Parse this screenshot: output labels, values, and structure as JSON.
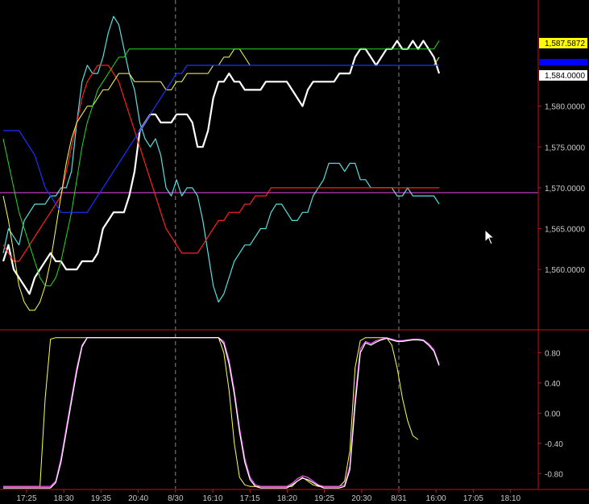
{
  "chart_data": [
    {
      "type": "line",
      "panel": "price",
      "ylim": [
        1553,
        1593
      ],
      "y_ticks": [
        "1,560.0000",
        "1,565.0000",
        "1,570.0000",
        "1,575.0000",
        "1,580.0000"
      ],
      "price_tags": [
        {
          "label": "1,587.5872",
          "bg": "#ffff00",
          "fg": "#000000",
          "value": 1587.5872
        },
        {
          "label": "",
          "bg": "#0000ff",
          "fg": "#ffffff",
          "value": 1585.4
        },
        {
          "label": "1,584.0000",
          "bg": "#ffffff",
          "fg": "#000000",
          "value": 1584.0
        }
      ],
      "hline": {
        "value": 1569.4,
        "color": "#cc44cc"
      },
      "series": [
        {
          "color": "#ffffff",
          "width": 2.2,
          "values": [
            1561,
            1563,
            1560,
            1559,
            1558,
            1557,
            1559,
            1560,
            1561,
            1562,
            1561,
            1561,
            1560,
            1560,
            1560,
            1561,
            1561,
            1561,
            1562,
            1565,
            1566,
            1567,
            1567,
            1567,
            1569,
            1572,
            1577,
            1578,
            1579,
            1579,
            1578,
            1578,
            1578,
            1579,
            1579,
            1579,
            1578,
            1575,
            1575,
            1577,
            1581,
            1583,
            1583,
            1584,
            1583,
            1583,
            1582,
            1582,
            1582,
            1582,
            1583,
            1583,
            1583,
            1583,
            1583,
            1582,
            1581,
            1580,
            1582,
            1583,
            1583,
            1583,
            1583,
            1583,
            1584,
            1584,
            1584,
            1586,
            1587,
            1587,
            1586,
            1585,
            1586,
            1587,
            1587,
            1588,
            1587,
            1587,
            1588,
            1587,
            1588,
            1587,
            1586,
            1584
          ]
        },
        {
          "color": "#55e0e0",
          "width": 1.2,
          "values": [
            1562,
            1565,
            1564,
            1563,
            1566,
            1567,
            1568,
            1568,
            1568,
            1569,
            1569,
            1570,
            1570,
            1572,
            1578,
            1583,
            1585,
            1584,
            1584,
            1586,
            1589,
            1591,
            1590,
            1587,
            1584,
            1582,
            1578,
            1576,
            1575,
            1576,
            1574,
            1570,
            1569,
            1571,
            1569,
            1570,
            1570,
            1569,
            1566,
            1562,
            1558,
            1556,
            1557,
            1559,
            1561,
            1562,
            1563,
            1563,
            1564,
            1565,
            1565,
            1567,
            1568,
            1568,
            1567,
            1566,
            1566,
            1567,
            1567,
            1569,
            1570,
            1571,
            1573,
            1573,
            1573,
            1572,
            1573,
            1573,
            1571,
            1571,
            1570,
            1570,
            1570,
            1570,
            1570,
            1569,
            1569,
            1570,
            1569,
            1569,
            1569,
            1569,
            1569,
            1568
          ]
        },
        {
          "color": "#ff2020",
          "width": 1.2,
          "values": [
            1563,
            1562,
            1561,
            1561,
            1562,
            1563,
            1564,
            1565,
            1566,
            1567,
            1568,
            1569,
            1572,
            1575,
            1578,
            1581,
            1583,
            1584,
            1585,
            1585,
            1585,
            1584,
            1583,
            1581,
            1579,
            1577,
            1575,
            1573,
            1571,
            1569,
            1567,
            1565,
            1564,
            1563,
            1562,
            1562,
            1562,
            1562,
            1563,
            1564,
            1565,
            1566,
            1566,
            1567,
            1567,
            1567,
            1568,
            1568,
            1569,
            1569,
            1569,
            1570,
            1570,
            1570,
            1570,
            1570,
            1570,
            1570,
            1570,
            1570,
            1570,
            1570,
            1570,
            1570,
            1570,
            1570,
            1570,
            1570,
            1570,
            1570,
            1570,
            1570,
            1570,
            1570,
            1570,
            1570,
            1570,
            1570,
            1570,
            1570,
            1570,
            1570,
            1570,
            1570
          ]
        },
        {
          "color": "#ffff55",
          "width": 1.0,
          "values": [
            1569,
            1566,
            1562,
            1558,
            1556,
            1555,
            1555,
            1556,
            1558,
            1561,
            1565,
            1569,
            1573,
            1576,
            1578,
            1579,
            1580,
            1580,
            1581,
            1582,
            1582,
            1583,
            1584,
            1584,
            1584,
            1583,
            1583,
            1583,
            1583,
            1583,
            1583,
            1582,
            1582,
            1583,
            1583,
            1584,
            1584,
            1584,
            1584,
            1584,
            1585,
            1585,
            1586,
            1586,
            1587,
            1587,
            1586,
            1585,
            1585,
            1585,
            1585,
            1585,
            1585,
            1585,
            1585,
            1585,
            1585,
            1585,
            1585,
            1585,
            1585,
            1585,
            1585,
            1585,
            1585,
            1585,
            1585,
            1585,
            1585,
            1585,
            1585,
            1585,
            1585,
            1585,
            1585,
            1585,
            1585,
            1585,
            1585,
            1585,
            1585,
            1585,
            1585,
            1586
          ]
        },
        {
          "color": "#22dd22",
          "width": 1.0,
          "values": [
            1576,
            1573,
            1570,
            1567,
            1565,
            1563,
            1561,
            1559,
            1558,
            1558,
            1559,
            1561,
            1564,
            1567,
            1571,
            1575,
            1578,
            1580,
            1582,
            1583,
            1584,
            1585,
            1586,
            1586,
            1587,
            1587,
            1587,
            1587,
            1587,
            1587,
            1587,
            1587,
            1587,
            1587,
            1587,
            1587,
            1587,
            1587,
            1587,
            1587,
            1587,
            1587,
            1587,
            1587,
            1587,
            1587,
            1587,
            1587,
            1587,
            1587,
            1587,
            1587,
            1587,
            1587,
            1587,
            1587,
            1587,
            1587,
            1587,
            1587,
            1587,
            1587,
            1587,
            1587,
            1587,
            1587,
            1587,
            1587,
            1587,
            1587,
            1587,
            1587,
            1587,
            1587,
            1587,
            1587,
            1587,
            1587,
            1587,
            1587,
            1587,
            1587,
            1587,
            1588
          ]
        },
        {
          "color": "#1f2fff",
          "width": 1.2,
          "values": [
            1577,
            1577,
            1577,
            1577,
            1576,
            1575,
            1574,
            1572,
            1570,
            1569,
            1568,
            1567,
            1567,
            1567,
            1567,
            1567,
            1567,
            1568,
            1569,
            1570,
            1571,
            1572,
            1573,
            1574,
            1575,
            1576,
            1577,
            1578,
            1579,
            1580,
            1581,
            1582,
            1583,
            1584,
            1584,
            1585,
            1585,
            1585,
            1585,
            1585,
            1585,
            1585,
            1585,
            1585,
            1585,
            1585,
            1585,
            1585,
            1585,
            1585,
            1585,
            1585,
            1585,
            1585,
            1585,
            1585,
            1585,
            1585,
            1585,
            1585,
            1585,
            1585,
            1585,
            1585,
            1585,
            1585,
            1585,
            1585,
            1585,
            1585,
            1585,
            1585,
            1585,
            1585,
            1585,
            1585,
            1585,
            1585,
            1585,
            1585,
            1585,
            1585,
            1585,
            1585
          ]
        }
      ]
    },
    {
      "type": "line",
      "panel": "oscillator",
      "ylim": [
        -1.0,
        1.05
      ],
      "y_ticks": [
        "0.80",
        "0.40",
        "0.00",
        "-0.40",
        "-0.80"
      ],
      "y_tick_values": [
        0.8,
        0.4,
        0.0,
        -0.4,
        -0.8
      ],
      "series": [
        {
          "color": "#ffff55",
          "width": 1.0,
          "values": [
            -0.97,
            -0.97,
            -0.97,
            -0.97,
            -0.97,
            -0.97,
            -0.97,
            -0.97,
            0.2,
            0.98,
            1,
            1,
            1,
            1,
            1,
            1,
            1,
            1,
            1,
            1,
            1,
            1,
            1,
            1,
            1,
            1,
            1,
            1,
            1,
            1,
            1,
            1,
            1,
            1,
            1,
            1,
            1,
            1,
            1,
            1,
            1,
            1,
            0.8,
            0.3,
            -0.4,
            -0.85,
            -0.95,
            -0.97,
            -0.97,
            -0.97,
            -0.97,
            -0.97,
            -0.97,
            -0.97,
            -0.97,
            -0.97,
            -0.9,
            -0.85,
            -0.9,
            -0.95,
            -0.97,
            -0.97,
            -0.97,
            -0.97,
            -0.97,
            -0.9,
            -0.5,
            0.6,
            0.96,
            1,
            1,
            1,
            1,
            1,
            0.9,
            0.6,
            0.2,
            -0.1,
            -0.3,
            -0.35
          ]
        },
        {
          "color": "#ff55ff",
          "width": 1.2,
          "values": [
            -0.97,
            -0.97,
            -0.97,
            -0.97,
            -0.97,
            -0.97,
            -0.97,
            -0.97,
            -0.97,
            -0.97,
            -0.9,
            -0.6,
            -0.2,
            0.2,
            0.6,
            0.9,
            1,
            1,
            1,
            1,
            1,
            1,
            1,
            1,
            1,
            1,
            1,
            1,
            1,
            1,
            1,
            1,
            1,
            1,
            1,
            1,
            1,
            1,
            1,
            1,
            1,
            1,
            0.95,
            0.7,
            0.3,
            -0.2,
            -0.6,
            -0.85,
            -0.95,
            -0.97,
            -0.97,
            -0.97,
            -0.97,
            -0.97,
            -0.97,
            -0.93,
            -0.87,
            -0.83,
            -0.85,
            -0.9,
            -0.95,
            -0.97,
            -0.97,
            -0.97,
            -0.97,
            -0.95,
            -0.7,
            0.2,
            0.85,
            0.95,
            0.92,
            0.96,
            0.98,
            1,
            0.98,
            0.96,
            0.96,
            0.97,
            0.98,
            0.98,
            0.97,
            0.92,
            0.84,
            0.65
          ]
        },
        {
          "color": "#ffffff",
          "width": 1.2,
          "values": [
            -0.99,
            -0.99,
            -0.99,
            -0.99,
            -0.99,
            -0.99,
            -0.99,
            -0.99,
            -0.99,
            -0.99,
            -0.92,
            -0.65,
            -0.25,
            0.15,
            0.55,
            0.88,
            1,
            1,
            1,
            1,
            1,
            1,
            1,
            1,
            1,
            1,
            1,
            1,
            1,
            1,
            1,
            1,
            1,
            1,
            1,
            1,
            1,
            1,
            1,
            1,
            1,
            1,
            0.92,
            0.65,
            0.25,
            -0.25,
            -0.65,
            -0.88,
            -0.97,
            -0.99,
            -0.99,
            -0.99,
            -0.99,
            -0.99,
            -0.99,
            -0.95,
            -0.9,
            -0.86,
            -0.88,
            -0.92,
            -0.96,
            -0.99,
            -0.99,
            -0.99,
            -0.99,
            -0.97,
            -0.75,
            0.1,
            0.8,
            0.93,
            0.9,
            0.94,
            0.97,
            0.99,
            0.97,
            0.95,
            0.95,
            0.96,
            0.97,
            0.97,
            0.96,
            0.9,
            0.82,
            0.63
          ]
        }
      ]
    }
  ],
  "x_axis": {
    "labels": [
      "17:25",
      "18:30",
      "19:35",
      "20:40",
      "8/30",
      "16:10",
      "17:15",
      "18:20",
      "19:25",
      "20:30",
      "8/31",
      "16:00",
      "17:05",
      "18:10"
    ],
    "session_breaks": [
      "8/30",
      "8/31"
    ]
  }
}
